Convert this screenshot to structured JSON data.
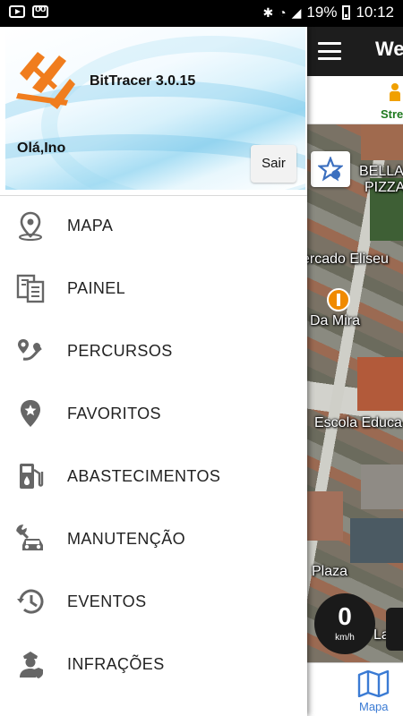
{
  "status_bar": {
    "battery": "19%",
    "time": "10:12"
  },
  "background_app": {
    "title": "We",
    "tab_label": "Stre",
    "map_labels": [
      "BELLA",
      "PIZZA",
      "ercado Eliseu",
      "Da Mira",
      "Escola Educa",
      "Plaza",
      "La"
    ],
    "speed_value": "0",
    "speed_unit": "km/h",
    "bottom_tab_label": "Mapa"
  },
  "drawer": {
    "app_name": "BitTracer 3.0.15",
    "greeting": "Olá,Ino",
    "logout_label": "Sair",
    "menu": [
      {
        "label": "MAPA",
        "icon": "map-pin-icon"
      },
      {
        "label": "PAINEL",
        "icon": "dashboard-icon"
      },
      {
        "label": "PERCURSOS",
        "icon": "route-icon"
      },
      {
        "label": "FAVORITOS",
        "icon": "star-pin-icon"
      },
      {
        "label": "ABASTECIMENTOS",
        "icon": "fuel-pump-icon"
      },
      {
        "label": "MANUTENÇÃO",
        "icon": "car-wrench-icon"
      },
      {
        "label": "EVENTOS",
        "icon": "history-icon"
      },
      {
        "label": "INFRAÇÕES",
        "icon": "officer-icon"
      }
    ]
  },
  "colors": {
    "logo": "#f07d1e",
    "icon_gray": "#666666",
    "map_tab": "#3b7bd4",
    "tab_green": "#1f7a1f"
  }
}
